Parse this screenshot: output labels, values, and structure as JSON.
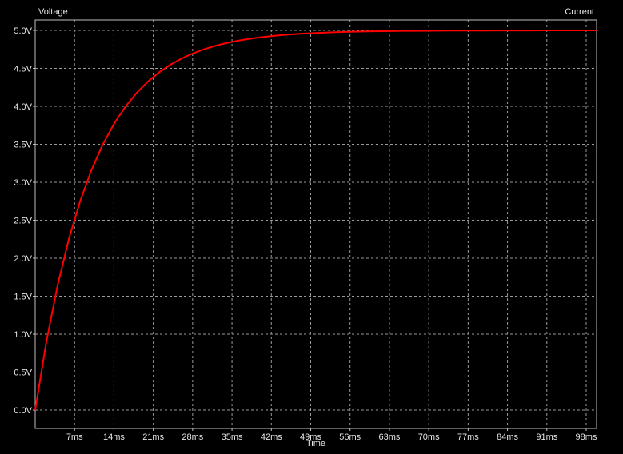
{
  "chart_data": {
    "type": "line",
    "title": "",
    "xlabel": "Time",
    "ylabel_left": "Voltage",
    "ylabel_right": "Current",
    "x_unit": "ms",
    "y_unit": "V",
    "xlim": [
      0,
      100
    ],
    "ylim": [
      0,
      5
    ],
    "grid": true,
    "background_color": "#000000",
    "grid_color": "#9a9a9a",
    "axis_color": "#bfbfbf",
    "text_color": "#e6e6e6",
    "x_ticks": [
      7,
      14,
      21,
      28,
      35,
      42,
      49,
      56,
      63,
      70,
      77,
      84,
      91,
      98
    ],
    "x_tick_labels": [
      "7ms",
      "14ms",
      "21ms",
      "28ms",
      "35ms",
      "42ms",
      "49ms",
      "56ms",
      "63ms",
      "70ms",
      "77ms",
      "84ms",
      "91ms",
      "98ms"
    ],
    "y_ticks": [
      0,
      0.5,
      1,
      1.5,
      2,
      2.5,
      3,
      3.5,
      4,
      4.5,
      5
    ],
    "y_tick_labels": [
      "0.0V",
      "0.5V",
      "1.0V",
      "1.5V",
      "2.0V",
      "2.5V",
      "3.0V",
      "3.5V",
      "4.0V",
      "4.5V",
      "5.0V"
    ],
    "series": [
      {
        "color": "#ff0000",
        "x": [
          0,
          2,
          4,
          6,
          8,
          10,
          12,
          14,
          16,
          18,
          20,
          22,
          24,
          26,
          28,
          30,
          32,
          34,
          36,
          38,
          40,
          42,
          44,
          46,
          48,
          50,
          52,
          54,
          56,
          58,
          60,
          62,
          64,
          66,
          68,
          70,
          72,
          74,
          76,
          78,
          80,
          82,
          84,
          86,
          88,
          90,
          92,
          94,
          96,
          98,
          100
        ],
        "y": [
          0,
          0.906,
          1.648,
          2.256,
          2.753,
          3.161,
          3.494,
          3.767,
          3.991,
          4.174,
          4.323,
          4.446,
          4.546,
          4.628,
          4.696,
          4.751,
          4.796,
          4.833,
          4.863,
          4.888,
          4.908,
          4.925,
          4.939,
          4.95,
          4.959,
          4.966,
          4.972,
          4.977,
          4.982,
          4.985,
          4.988,
          4.99,
          4.992,
          4.993,
          4.994,
          4.995,
          4.996,
          4.997,
          4.998,
          4.998,
          4.998,
          4.999,
          4.999,
          4.999,
          4.999,
          5.0,
          5.0,
          5.0,
          5.0,
          5.0,
          5.0
        ]
      }
    ]
  }
}
